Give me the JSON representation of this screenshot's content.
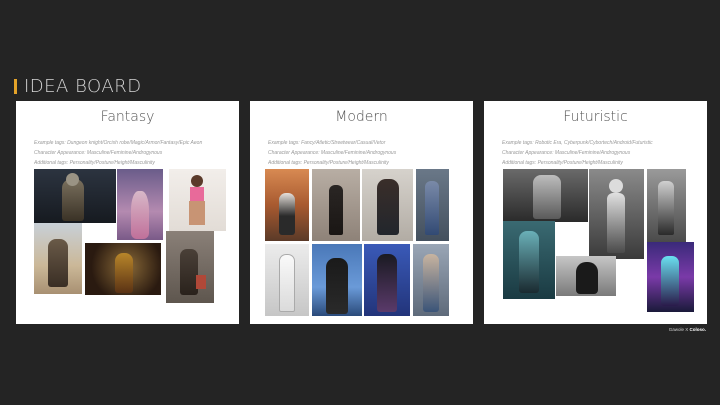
{
  "board": {
    "title": "IDEA BOARD",
    "accent_color": "#e4a329"
  },
  "cards": [
    {
      "title": "Fantasy",
      "lines": [
        "Example tags: Dungeon knight/Orcish robe/Magic/Armor/Fantasy/Epic Aeon",
        "Character Appearance: Masculine/Feminine/Androgynous",
        "Additional tags: Personality/Posture/Height/Masculinity"
      ]
    },
    {
      "title": "Modern",
      "lines": [
        "Example tags: Fancy/Atletic/Streetwear/Casual/Vetor",
        "Character Appearance: Masculine/Feminine/Androgynous",
        "Additional tags: Personality/Posture/Height/Masculinity"
      ]
    },
    {
      "title": "Futuristic",
      "lines": [
        "Example tags: Robotic Era, Cyberpunk/Cybortech/Android/Futuristic",
        "Character Appearance: Masculine/Feminine/Androgynous",
        "Additional tags: Personality/Posture/Height/Masculinity"
      ]
    }
  ],
  "brand": {
    "prefix": "Gawole",
    "joiner": "X",
    "name": "Coloso."
  }
}
